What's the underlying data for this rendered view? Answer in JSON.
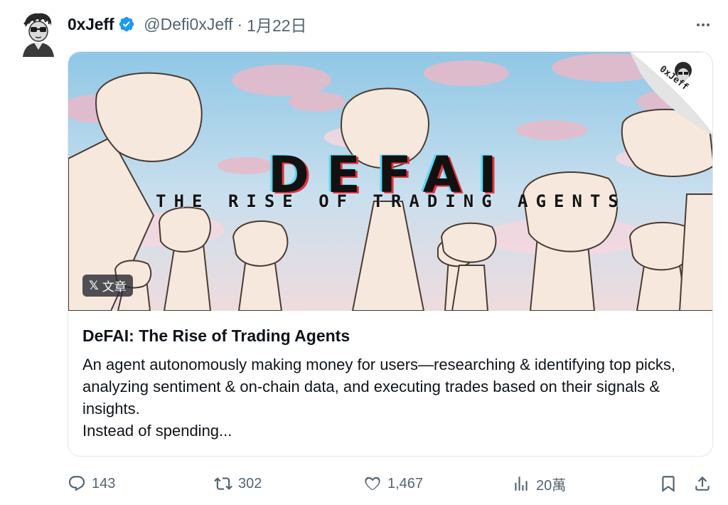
{
  "author": {
    "display_name": "0xJeff",
    "handle": "@Defi0xJeff",
    "separator": "·",
    "date": "1月22日",
    "verified": true
  },
  "card": {
    "image_headline": "DEFAI",
    "image_subline": "THE RISE OF TRADING AGENTS",
    "image_corner_tag": "0xJeff",
    "badge_label": "文章",
    "title": "DeFAI: The Rise of Trading Agents",
    "description": "An agent autonomously making money for users—researching & identifying top picks, analyzing sentiment & on-chain data, and executing trades based on their signals & insights.\nInstead of spending..."
  },
  "actions": {
    "replies": "143",
    "reposts": "302",
    "likes": "1,467",
    "views": "20萬"
  },
  "icons": {
    "more": "more-icon",
    "verified": "verified-badge-icon",
    "reply": "reply-icon",
    "repost": "repost-icon",
    "like": "heart-icon",
    "views": "views-icon",
    "bookmark": "bookmark-icon",
    "share": "share-icon"
  },
  "colors": {
    "verified_blue": "#1d9bf0",
    "muted_text": "#536471",
    "card_border": "#e1e8ed"
  }
}
